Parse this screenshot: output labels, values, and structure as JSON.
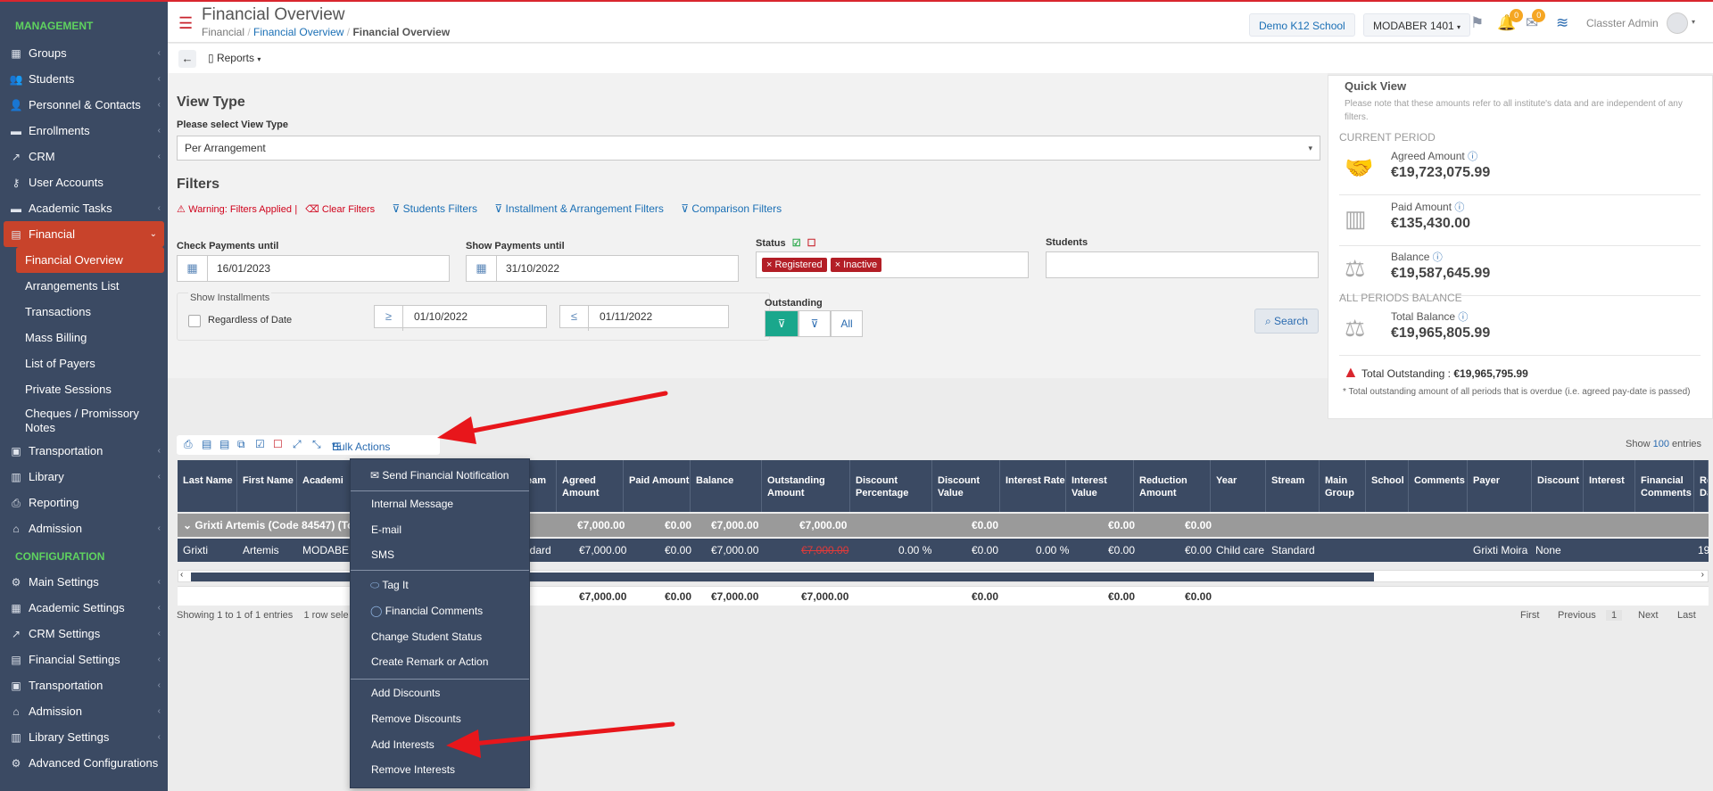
{
  "sidebar": {
    "management_label": "MANAGEMENT",
    "management": [
      {
        "label": "Groups",
        "icon": "groups-icon"
      },
      {
        "label": "Students",
        "icon": "students-icon"
      },
      {
        "label": "Personnel & Contacts",
        "icon": "personnel-icon"
      },
      {
        "label": "Enrollments",
        "icon": "enrollments-icon"
      },
      {
        "label": "CRM",
        "icon": "crm-icon"
      },
      {
        "label": "User Accounts",
        "icon": "key-icon"
      },
      {
        "label": "Academic Tasks",
        "icon": "tasks-icon"
      },
      {
        "label": "Financial",
        "icon": "financial-icon"
      }
    ],
    "financial_sub": [
      "Financial Overview",
      "Arrangements List",
      "Transactions",
      "Mass Billing",
      "List of Payers",
      "Private Sessions",
      "Cheques / Promissory Notes"
    ],
    "management_after": [
      {
        "label": "Transportation",
        "icon": "bus-icon"
      },
      {
        "label": "Library",
        "icon": "library-icon"
      },
      {
        "label": "Reporting",
        "icon": "printer-icon"
      },
      {
        "label": "Admission",
        "icon": "admission-icon"
      }
    ],
    "configuration_label": "CONFIGURATION",
    "configuration": [
      {
        "label": "Main Settings",
        "icon": "settings-icon"
      },
      {
        "label": "Academic Settings",
        "icon": "academic-settings-icon"
      },
      {
        "label": "CRM Settings",
        "icon": "crm-settings-icon"
      },
      {
        "label": "Financial Settings",
        "icon": "financial-settings-icon"
      },
      {
        "label": "Transportation",
        "icon": "bus-icon"
      },
      {
        "label": "Admission",
        "icon": "admission-icon"
      },
      {
        "label": "Library Settings",
        "icon": "library-icon"
      },
      {
        "label": "Advanced Configurations",
        "icon": "advanced-icon"
      }
    ]
  },
  "header": {
    "title": "Financial Overview",
    "breadcrumb": [
      "Financial",
      "Financial Overview",
      "Financial Overview"
    ],
    "school_button": "Demo K12 School",
    "year_button": "MODABER 1401",
    "notif_count": "0",
    "mail_count": "0",
    "user": "Classter Admin"
  },
  "toolbar": {
    "reports_label": "Reports"
  },
  "view_type": {
    "heading": "View Type",
    "label": "Please select View Type",
    "value": "Per Arrangement"
  },
  "filters": {
    "heading": "Filters",
    "warning": "Warning: Filters Applied",
    "clear": "Clear Filters",
    "students_filters": "Students Filters",
    "installment_filters": "Installment & Arrangement Filters",
    "comparison_filters": "Comparison Filters",
    "check_payments_label": "Check Payments until",
    "check_payments_value": "16/01/2023",
    "show_payments_label": "Show Payments until",
    "show_payments_value": "31/10/2022",
    "status_label": "Status",
    "status_tags": [
      "Registered",
      "Inactive"
    ],
    "students_label": "Students",
    "show_installments_label": "Show Installments",
    "regardless_label": "Regardless of Date",
    "from_value": "01/10/2022",
    "to_value": "01/11/2022",
    "outstanding_label": "Outstanding",
    "outstanding_all": "All",
    "search_label": "Search"
  },
  "quick_view": {
    "title": "Quick View",
    "note": "Please note that these amounts refer to all institute's data and are independent of any filters.",
    "current_period": "CURRENT PERIOD",
    "agreed_label": "Agreed Amount",
    "agreed_value": "€19,723,075.99",
    "paid_label": "Paid Amount",
    "paid_value": "€135,430.00",
    "balance_label": "Balance",
    "balance_value": "€19,587,645.99",
    "all_periods": "ALL PERIODS BALANCE",
    "total_balance_label": "Total Balance",
    "total_balance_value": "€19,965,805.99",
    "total_outstanding_label": "Total Outstanding :",
    "total_outstanding_value": "€19,965,795.99",
    "total_outstanding_note": "* Total outstanding amount of all periods that is overdue (i.e. agreed pay-date is passed)"
  },
  "table": {
    "bulk_actions": "Bulk Actions",
    "show_label": "Show",
    "show_value": "100",
    "entries_label": "entries",
    "headers": [
      "Last Name",
      "First Name",
      "Academi",
      "eam",
      "Agreed Amount",
      "Paid Amount",
      "Balance",
      "Outstanding Amount",
      "Discount Percentage",
      "Discount Value",
      "Interest Rate",
      "Interest Value",
      "Reduction Amount",
      "Year",
      "Stream",
      "Main Group",
      "School",
      "Comments",
      "Payer",
      "Discount",
      "Interest",
      "Financial Comments",
      "Re Da"
    ],
    "group_label": "Grixti Artemis (Code 84547) (To",
    "group_values": [
      "€7,000.00",
      "€0.00",
      "€7,000.00",
      "€7,000.00",
      "€0.00",
      "€0.00",
      "€0.00"
    ],
    "row": {
      "last_name": "Grixti",
      "first_name": "Artemis",
      "academic": "MODABER",
      "stream_part": "ndard",
      "agreed": "€7,000.00",
      "paid": "€0.00",
      "balance": "€7,000.00",
      "outstanding": "€7,000.00",
      "discount_pct": "0.00 %",
      "discount_val": "€0.00",
      "interest_rate": "0.00 %",
      "interest_val": "€0.00",
      "reduction": "€0.00",
      "year": "Child care",
      "stream": "Standard",
      "payer": "Grixti Moira",
      "discount": "None",
      "re_da": "19"
    },
    "footer_values": [
      "€7,000.00",
      "€0.00",
      "€7,000.00",
      "€7,000.00",
      "€0.00",
      "€0.00",
      "€0.00"
    ],
    "showing": "Showing 1 to 1 of 1 entries",
    "row_selected": "1 row sele",
    "pager": {
      "first": "First",
      "previous": "Previous",
      "page": "1",
      "next": "Next",
      "last": "Last"
    }
  },
  "bulk_menu": {
    "group1": [
      "Send Financial Notification"
    ],
    "group2": [
      "Internal Message",
      "E-mail",
      "SMS"
    ],
    "group3": [
      "Tag It",
      "Financial Comments",
      "Change Student Status",
      "Create Remark or Action"
    ],
    "group4": [
      "Add Discounts",
      "Remove Discounts",
      "Add Interests",
      "Remove Interests"
    ]
  },
  "colors": {
    "sidebar_bg": "#3b4a63",
    "active_red": "#c8432b",
    "section_green": "#5fd35f",
    "link_blue": "#1a6fb5",
    "arrow_red": "#e8161b"
  }
}
